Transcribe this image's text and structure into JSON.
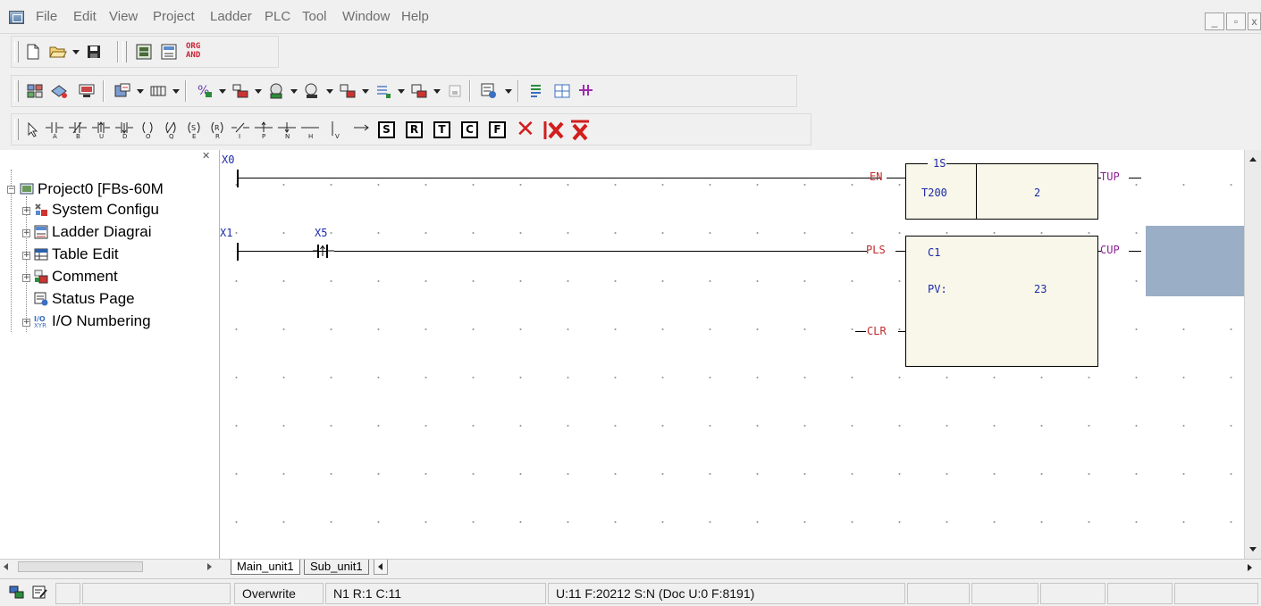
{
  "menu": {
    "items": [
      "File",
      "Edit",
      "View",
      "Project",
      "Ladder",
      "PLC",
      "Tool",
      "Window",
      "Help"
    ]
  },
  "window_controls": {
    "minimize": "_",
    "restore": "▫",
    "close": "x"
  },
  "toolbar1": {
    "icons": [
      "new-file-icon",
      "open-folder-icon",
      "save-icon",
      "ladder-view-icon",
      "diagram-view-icon",
      "org-and-icon"
    ],
    "org_label_top": "ORG",
    "org_label_bottom": "AND"
  },
  "toolbar3": {
    "box_buttons": [
      "S",
      "R",
      "T",
      "C",
      "F"
    ]
  },
  "tree": {
    "items": [
      {
        "label": "Project0 [FBs-60M",
        "icon": "project-icon"
      },
      {
        "label": "System Configu",
        "icon": "system-config-icon"
      },
      {
        "label": "Ladder Diagrai",
        "icon": "ladder-diagram-icon"
      },
      {
        "label": "Table Edit",
        "icon": "table-edit-icon"
      },
      {
        "label": "Comment",
        "icon": "comment-icon"
      },
      {
        "label": "Status Page",
        "icon": "status-page-icon"
      },
      {
        "label": "I/O Numbering",
        "icon": "io-numbering-icon"
      }
    ]
  },
  "ladder": {
    "rung1": {
      "contact": "X0",
      "en": "EN",
      "time_base": "1S",
      "timer": "T200",
      "preset": "2",
      "output": "TUP"
    },
    "rung2": {
      "contact1": "X1",
      "contact2": "X5",
      "pls": "PLS",
      "clr": "CLR",
      "counter": "C1",
      "pv_label": "PV:",
      "pv_value": "23",
      "output": "CUP"
    }
  },
  "sheet_tabs": [
    "Main_unit1",
    "Sub_unit1"
  ],
  "status": {
    "mode": "Overwrite",
    "position": "N1 R:1 C:11",
    "memory": "U:11 F:20212 S:N (Doc U:0 F:8191)"
  },
  "colors": {
    "address_blue": "#1d2aa8",
    "pin_red": "#c22b2b",
    "output_purple": "#8b1d93",
    "fb_fill": "#f8f7ea",
    "selection": "#9aaec6"
  }
}
